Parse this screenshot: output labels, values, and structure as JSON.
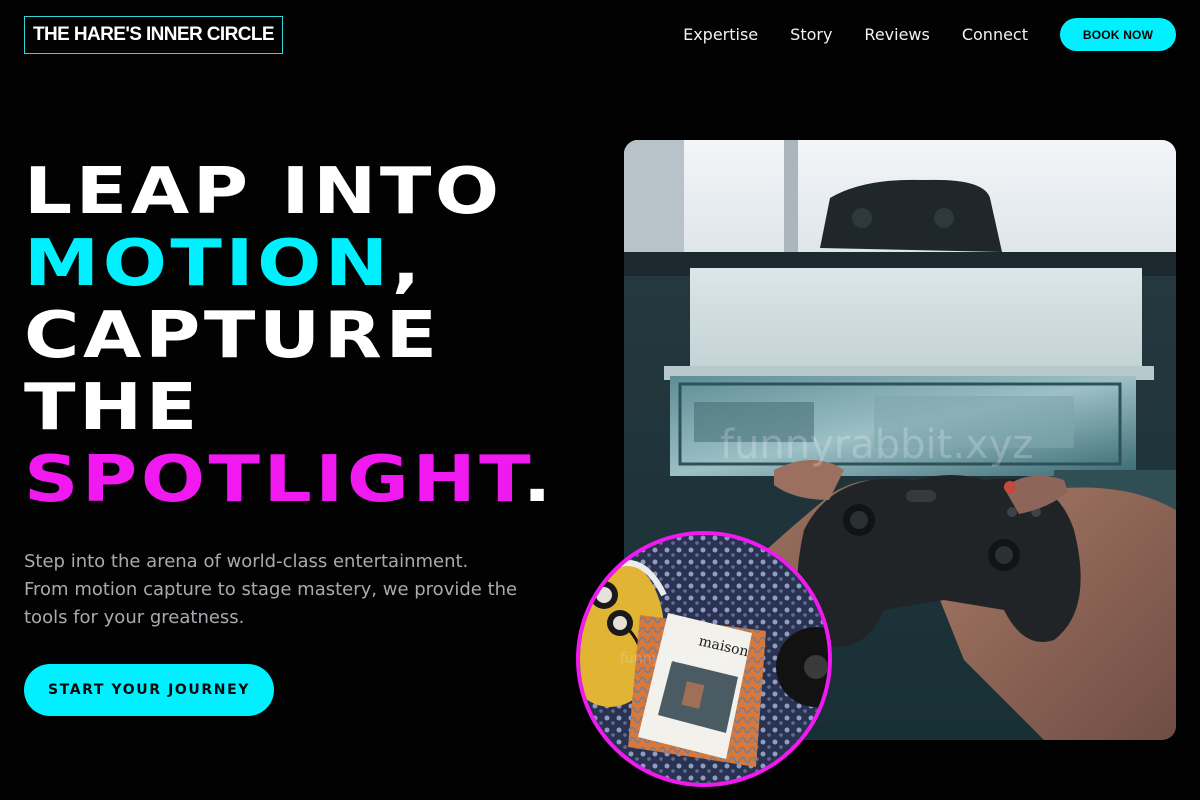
{
  "header": {
    "logo": "THE HARE'S INNER CIRCLE",
    "nav": [
      "Expertise",
      "Story",
      "Reviews",
      "Connect"
    ],
    "book_button": "BOOK NOW"
  },
  "hero": {
    "line1": "LEAP INTO",
    "line2_highlight": "MOTION",
    "line2_suffix": ",",
    "line3": "CAPTURE",
    "line4": "THE",
    "line5_highlight": "SPOTLIGHT",
    "line5_suffix": ".",
    "description_lines": [
      "Step into the arena of world-class entertainment.",
      "From motion capture to stage mastery, we provide the",
      "tools for your greatness."
    ],
    "cta": "START YOUR JOURNEY"
  },
  "images": {
    "main_watermark": "funnyrabbit.xyz",
    "inset_magazine_title": "maison",
    "inset_watermark": "funnyrabbit.xyz"
  },
  "colors": {
    "background": "#020202",
    "accent_cyan": "#00f0ff",
    "accent_magenta": "#f019f0"
  }
}
